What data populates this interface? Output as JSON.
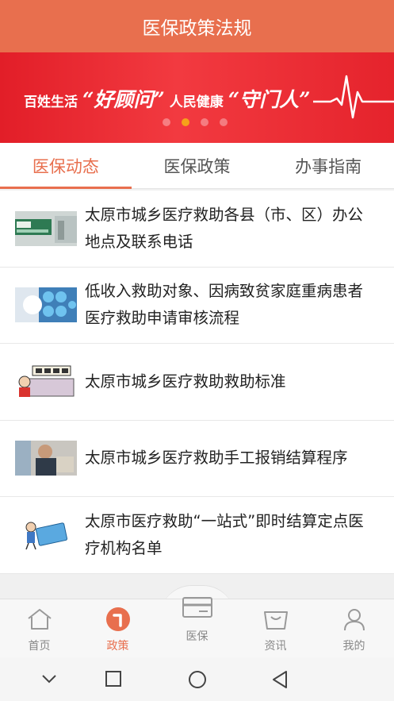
{
  "header": {
    "title": "医保政策法规"
  },
  "banner": {
    "slogan_part1": "百姓生活",
    "slogan_quote1": "“好顾问”",
    "slogan_part2": "人民健康",
    "slogan_quote2": "“守门人”",
    "dots": 4,
    "active_dot": 1
  },
  "tabs": [
    {
      "label": "医保动态",
      "active": true
    },
    {
      "label": "医保政策",
      "active": false
    },
    {
      "label": "办事指南",
      "active": false
    }
  ],
  "articles": [
    {
      "title": "太原市城乡医疗救助各县（市、区）办公地点及联系电话",
      "thumb": "medical-office-sign"
    },
    {
      "title": "低收入救助对象、因病致贫家庭重病患者医疗救助申请审核流程",
      "thumb": "healthcare-icons"
    },
    {
      "title": "太原市城乡医疗救助救助标准",
      "thumb": "relief-standard-cartoon"
    },
    {
      "title": "太原市城乡医疗救助手工报销结算程序",
      "thumb": "elderly-man-photo"
    },
    {
      "title": "太原市医疗救助“一站式”即时结算定点医疗机构名单",
      "thumb": "insurance-card-cartoon"
    }
  ],
  "bottom_nav": [
    {
      "label": "首页",
      "icon": "home-icon",
      "active": false
    },
    {
      "label": "政策",
      "icon": "policy-icon",
      "active": true
    },
    {
      "label": "医保",
      "icon": "card-icon",
      "active": false
    },
    {
      "label": "资讯",
      "icon": "news-icon",
      "active": false
    },
    {
      "label": "我的",
      "icon": "user-icon",
      "active": false
    }
  ],
  "colors": {
    "accent": "#e86f4e",
    "banner_red": "#e21e28",
    "dot_active": "#f6a11a"
  }
}
